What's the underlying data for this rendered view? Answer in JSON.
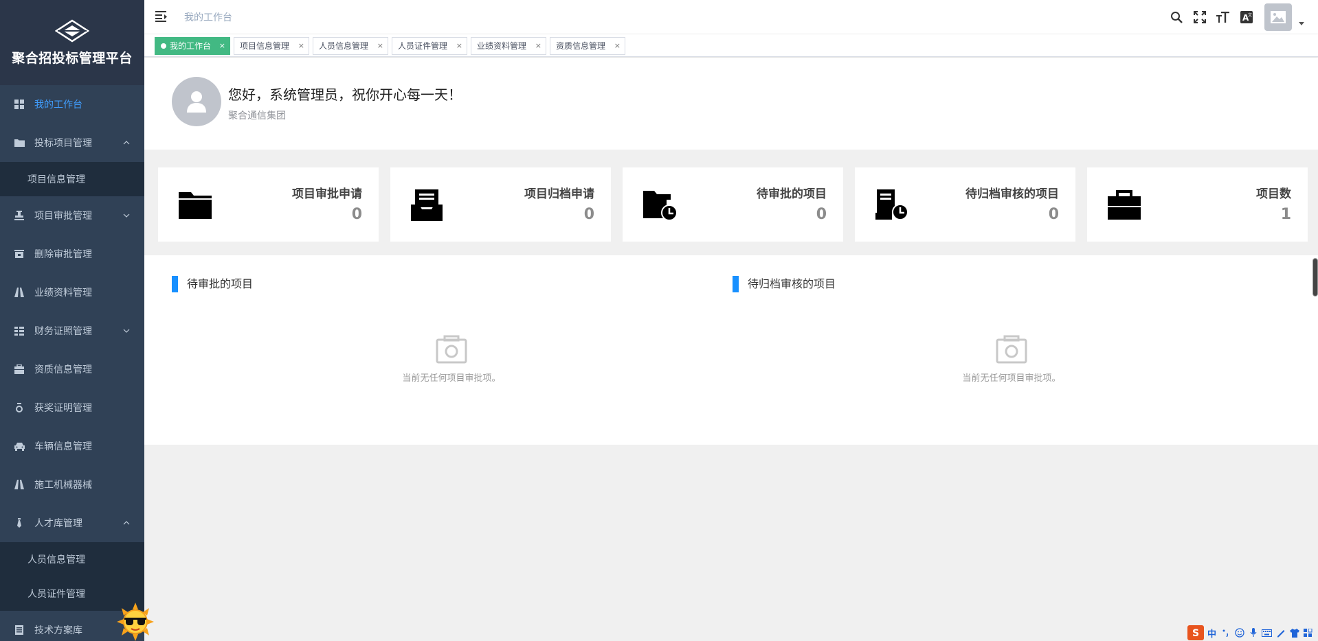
{
  "app": {
    "title": "聚合招投标管理平台"
  },
  "sidebar": {
    "items": [
      {
        "label": "我的工作台",
        "icon": "dashboard-icon",
        "active": true
      },
      {
        "label": "投标项目管理",
        "icon": "folder-icon",
        "expanded": true,
        "children": [
          {
            "label": "项目信息管理"
          }
        ]
      },
      {
        "label": "项目审批管理",
        "icon": "stamp-icon",
        "expanded": false
      },
      {
        "label": "删除审批管理",
        "icon": "bank-icon"
      },
      {
        "label": "业绩资料管理",
        "icon": "road-icon"
      },
      {
        "label": "财务证照管理",
        "icon": "list-icon",
        "expanded": false
      },
      {
        "label": "资质信息管理",
        "icon": "case-icon"
      },
      {
        "label": "获奖证明管理",
        "icon": "medal-icon"
      },
      {
        "label": "车辆信息管理",
        "icon": "car-icon"
      },
      {
        "label": "施工机械器械",
        "icon": "road-icon"
      },
      {
        "label": "人才库管理",
        "icon": "tie-icon",
        "expanded": true,
        "children": [
          {
            "label": "人员信息管理"
          },
          {
            "label": "人员证件管理"
          }
        ]
      },
      {
        "label": "技术方案库",
        "icon": "document-icon"
      }
    ]
  },
  "header": {
    "breadcrumb": "我的工作台",
    "tools": [
      "search-icon",
      "fullscreen-icon",
      "font-size-icon",
      "translate-icon"
    ],
    "avatar_icon": "image-icon"
  },
  "tags": [
    {
      "label": "我的工作台",
      "active": true
    },
    {
      "label": "项目信息管理"
    },
    {
      "label": "人员信息管理"
    },
    {
      "label": "人员证件管理"
    },
    {
      "label": "业绩资料管理"
    },
    {
      "label": "资质信息管理"
    }
  ],
  "tag_close": "×",
  "welcome": {
    "greeting": "您好，系统管理员，祝你开心每一天！",
    "org": "聚合通信集团"
  },
  "stats": [
    {
      "title": "项目审批申请",
      "value": "0",
      "icon": "folder-icon"
    },
    {
      "title": "项目归档申请",
      "value": "0",
      "icon": "inbox-icon"
    },
    {
      "title": "待审批的项目",
      "value": "0",
      "icon": "folder-clock-icon"
    },
    {
      "title": "待归档审核的项目",
      "value": "0",
      "icon": "doc-clock-icon"
    },
    {
      "title": "项目数",
      "value": "1",
      "icon": "briefcase-icon"
    }
  ],
  "sections": [
    {
      "title": "待审批的项目",
      "empty_text": "当前无任何项目审批项。"
    },
    {
      "title": "待归档审核的项目",
      "empty_text": "当前无任何项目审批项。"
    }
  ],
  "ime": {
    "label": "中",
    "brand_icon": "sogou-s-icon"
  },
  "colors": {
    "sidebar": "#304156",
    "accent": "#409eff",
    "tag_active": "#42b983",
    "section_bar": "#1890ff"
  }
}
